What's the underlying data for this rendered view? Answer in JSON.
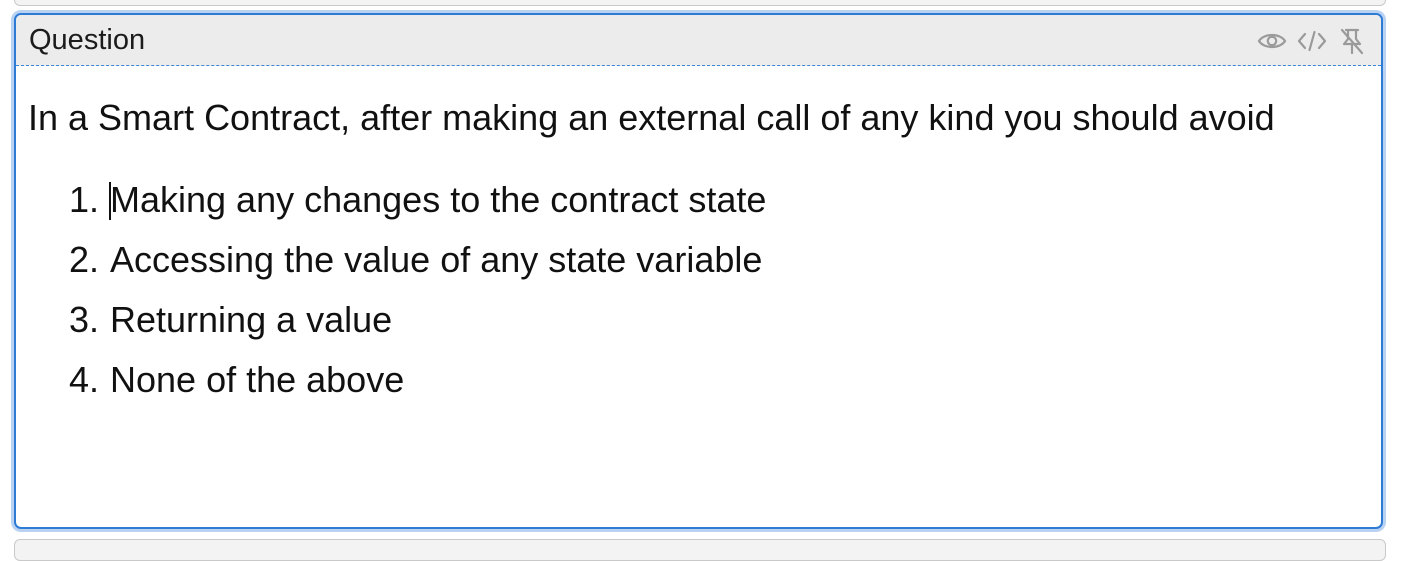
{
  "panel": {
    "title": "Question",
    "icons": [
      "eye-icon",
      "code-icon",
      "unpin-icon"
    ]
  },
  "question": {
    "text": "In a Smart Contract, after making an external call of any kind you should avoid",
    "options": [
      {
        "number": "1.",
        "text": "Making any changes to the contract state"
      },
      {
        "number": "2.",
        "text": "Accessing the value of any state variable"
      },
      {
        "number": "3.",
        "text": "Returning a value"
      },
      {
        "number": "4.",
        "text": "None of the above"
      }
    ]
  },
  "colors": {
    "accent": "#2e7bd6",
    "header_bg": "#ececec",
    "icon": "#9a9a9a"
  }
}
